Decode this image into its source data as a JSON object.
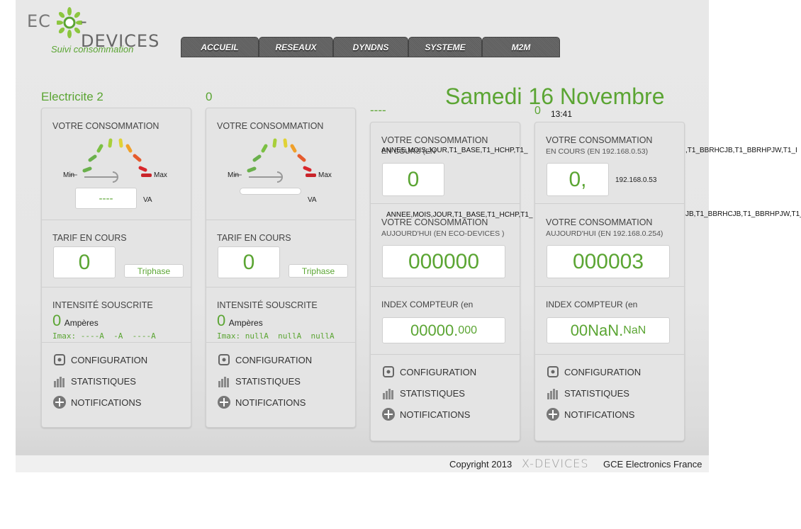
{
  "brand": {
    "logo_left": "EC",
    "logo_right": "-DEVICES",
    "subtitle": "Suivi consommation"
  },
  "nav": {
    "tabs": [
      "ACCUEIL",
      "RESEAUX",
      "DYNDNS",
      "SYSTEME",
      "M2M"
    ]
  },
  "header": {
    "date": "Samedi 16 Novembre",
    "time": "13:41",
    "zero": "0"
  },
  "cards": [
    {
      "title": "Electricite 2",
      "consumption_label": "VOTRE CONSOMMATION",
      "gauge_min": "Min",
      "gauge_max": "Max",
      "gauge_value": "----",
      "gauge_unit": "VA",
      "tarif_label": "TARIF EN COURS",
      "tarif_value": "0",
      "tarif_type": "Triphase",
      "intensity_label": "INTENSITÉ SOUSCRITE",
      "intensity_value": "0",
      "intensity_unit": "Ampères",
      "imax": "Imax: ----A  -A  ----A",
      "menu": [
        "CONFIGURATION",
        "STATISTIQUES",
        "NOTIFICATIONS"
      ]
    },
    {
      "title": "0",
      "consumption_label": "VOTRE CONSOMMATION",
      "gauge_min": "Min",
      "gauge_max": "Max",
      "gauge_value": "",
      "gauge_unit": "VA",
      "tarif_label": "TARIF EN COURS",
      "tarif_value": "0",
      "tarif_type": "Triphase",
      "intensity_label": "INTENSITÉ SOUSCRITE",
      "intensity_value": "0",
      "intensity_unit": "Ampères",
      "imax": "Imax: nullA  nullA  nullA",
      "menu": [
        "CONFIGURATION",
        "STATISTIQUES",
        "NOTIFICATIONS"
      ]
    },
    {
      "title": "----",
      "consumption_label": "VOTRE CONSOMMATION",
      "consumption_sub": "EN COURS (EN",
      "overlay_top": "ANNEE,MOIS,JOUR,T1_BASE,T1_HCHP,T1_",
      "current_value": "0",
      "overlay_mid": "ANNEE,MOIS,JOUR,T1_BASE,T1_HCHP,T1_",
      "today_label": "VOTRE CONSOMMATION",
      "today_sub": "AUJOURD'HUI (EN ECO-DEVICES )",
      "today_value": "000000",
      "index_label": "INDEX COMPTEUR (en",
      "index_value": "00000.",
      "index_decimal": "000",
      "menu": [
        "CONFIGURATION",
        "STATISTIQUES",
        "NOTIFICATIONS"
      ]
    },
    {
      "title": "",
      "consumption_label": "VOTRE CONSOMMATION",
      "consumption_sub": "EN COURS (EN 192.168.0.53)",
      "overlay_top": ",T1_BBRHCJB,T1_BBRHPJW,T1_I",
      "current_value": "0,",
      "side_ip": "192.168.0.53",
      "overlay_mid": "JB,T1_BBRHCJB,T1_BBRHPJW,T1_",
      "today_label": "VOTRE CONSOMMATION",
      "today_sub": "AUJOURD'HUI (EN 192.168.0.254)",
      "today_value": "000003",
      "index_label": "INDEX COMPTEUR (en",
      "index_value": "00NaN.",
      "index_decimal": "NaN",
      "menu": [
        "CONFIGURATION",
        "STATISTIQUES",
        "NOTIFICATIONS"
      ]
    }
  ],
  "footer": {
    "copyright": "Copyright 2013",
    "xdevices": "X-DEVICES",
    "company": "GCE Electronics France"
  },
  "colors": {
    "accent": "#5ba533",
    "nav_bg": "#5d5d5d",
    "card_bg": "#e4e4e4"
  }
}
